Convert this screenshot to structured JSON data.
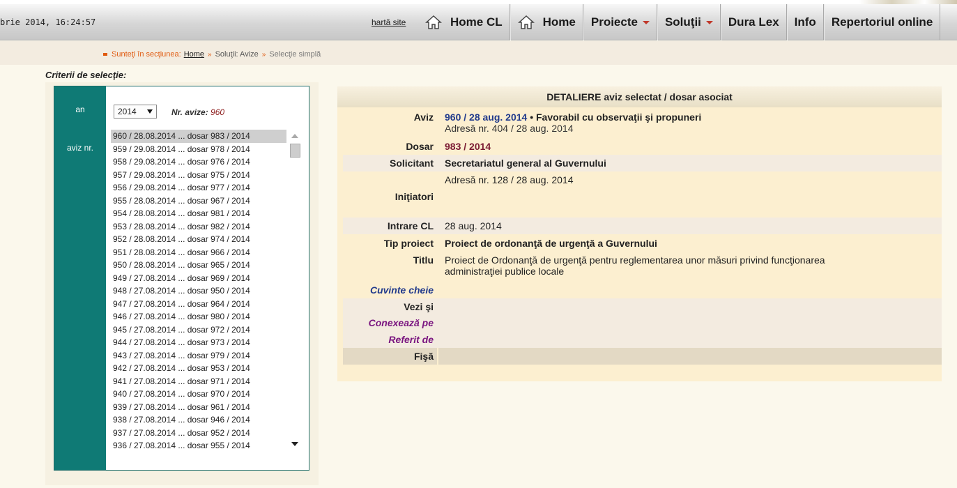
{
  "header": {
    "datetime": "brie 2014, 16:24:57",
    "sitemap_label": "hartă site",
    "nav": [
      {
        "label": "Home CL",
        "icon": "house-icon",
        "dropdown": false
      },
      {
        "label": "Home",
        "icon": "house-icon",
        "dropdown": false
      },
      {
        "label": "Proiecte",
        "icon": null,
        "dropdown": true
      },
      {
        "label": "Soluţii",
        "icon": null,
        "dropdown": true
      },
      {
        "label": "Dura Lex",
        "icon": null,
        "dropdown": false
      },
      {
        "label": "Info",
        "icon": null,
        "dropdown": false
      },
      {
        "label": "Repertoriul online",
        "icon": null,
        "dropdown": false
      }
    ]
  },
  "breadcrumb": {
    "prefix": "Sunteţi în secţiunea:",
    "home": "Home",
    "section": "Soluţii: Avize",
    "current": "Selecţie simplă"
  },
  "criteria": {
    "title": "Criterii de selecţie:",
    "year_label": "an",
    "year_value": "2014",
    "count_label": "Nr. avize:",
    "count_value": "960",
    "aviz_label": "aviz nr.",
    "items": [
      "960 / 28.08.2014 ... dosar 983 / 2014",
      "959 / 29.08.2014 ... dosar 978 / 2014",
      "958 / 29.08.2014 ... dosar 976 / 2014",
      "957 / 29.08.2014 ... dosar 975 / 2014",
      "956 / 29.08.2014 ... dosar 977 / 2014",
      "955 / 28.08.2014 ... dosar 967 / 2014",
      "954 / 28.08.2014 ... dosar 981 / 2014",
      "953 / 28.08.2014 ... dosar 982 / 2014",
      "952 / 28.08.2014 ... dosar 974 / 2014",
      "951 / 28.08.2014 ... dosar 966 / 2014",
      "950 / 28.08.2014 ... dosar 965 / 2014",
      "949 / 27.08.2014 ... dosar 969 / 2014",
      "948 / 27.08.2014 ... dosar 950 / 2014",
      "947 / 27.08.2014 ... dosar 964 / 2014",
      "946 / 27.08.2014 ... dosar 980 / 2014",
      "945 / 27.08.2014 ... dosar 972 / 2014",
      "944 / 27.08.2014 ... dosar 973 / 2014",
      "943 / 27.08.2014 ... dosar 979 / 2014",
      "942 / 27.08.2014 ... dosar 953 / 2014",
      "941 / 27.08.2014 ... dosar 971 / 2014",
      "940 / 27.08.2014 ... dosar 970 / 2014",
      "939 / 27.08.2014 ... dosar 961 / 2014",
      "938 / 27.08.2014 ... dosar 946 / 2014",
      "937 / 27.08.2014 ... dosar 952 / 2014",
      "936 / 27.08.2014 ... dosar 955 / 2014"
    ],
    "selected_index": 0
  },
  "detail": {
    "title": "DETALIERE aviz selectat / dosar asociat",
    "aviz_label": "Aviz",
    "aviz_link": "960 / 28 aug. 2014",
    "aviz_bullet": "•",
    "aviz_status": "Favorabil cu observaţii şi propuneri",
    "aviz_address": "Adresă nr. 404 / 28 aug. 2014",
    "dosar_label": "Dosar",
    "dosar_nr": "983",
    "dosar_sep": "/",
    "dosar_year": "2014",
    "solicitant_label": "Solicitant",
    "solicitant_value": "Secretariatul general al Guvernului",
    "initiatori_label": "Iniţiatori",
    "initiatori_value": "Adresă nr. 128 / 28 aug. 2014",
    "intrare_label": "Intrare CL",
    "intrare_value": "28 aug. 2014",
    "tip_label": "Tip proiect",
    "tip_value": "Proiect de ordonanţă de urgenţă a Guvernului",
    "titlu_label": "Titlu",
    "titlu_value": "Proiect de Ordonanţă de urgenţă pentru reglementarea unor măsuri privind funcţionarea administraţiei publice locale",
    "cuvinte_label": "Cuvinte cheie",
    "vezi_label": "Vezi şi",
    "conexeaza_label": "Conexează pe",
    "referit_label": "Referit de",
    "fisa_label": "Fişă"
  }
}
